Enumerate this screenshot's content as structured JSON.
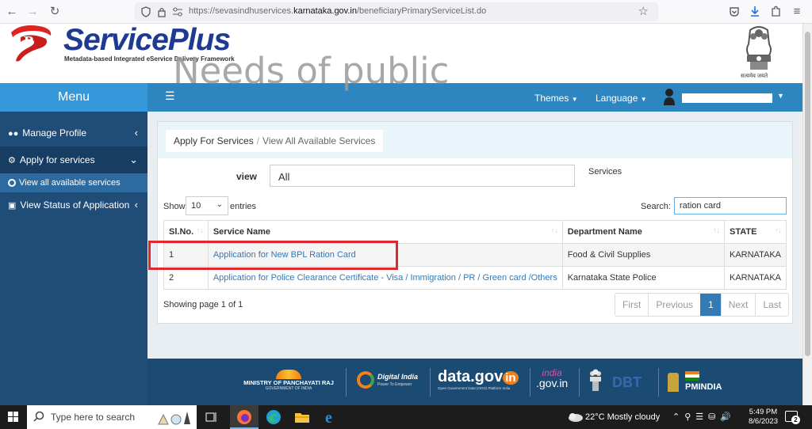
{
  "browser": {
    "url_prefix": "https://sevasindhuservices.",
    "url_domain": "karnataka.gov.in",
    "url_path": "/beneficiaryPrimaryServiceList.do"
  },
  "header": {
    "brand": "ServicePlus",
    "tagline": "Metadata-based Integrated eService Delivery Framework",
    "emblem_motto": "सत्यमेव जयते"
  },
  "sidebar": {
    "menu_title": "Menu",
    "items": [
      {
        "label": "Manage Profile",
        "icon": "users-icon"
      },
      {
        "label": "Apply for services",
        "icon": "cogs-icon"
      },
      {
        "label": "View Status of Application",
        "icon": "desktop-icon"
      }
    ],
    "subitem": "View all available services"
  },
  "topbar": {
    "themes": "Themes",
    "language": "Language"
  },
  "breadcrumb": {
    "root": "Apply For Services",
    "current": "View All Available Services"
  },
  "filters": {
    "view_label": "view",
    "view_value": "All",
    "services_label": "Services",
    "show_label": "Show",
    "entries_value": "10",
    "entries_label": "entries",
    "search_label": "Search:",
    "search_value": "ration card"
  },
  "watermark": "Needs of public",
  "table": {
    "headers": [
      "Sl.No.",
      "Service Name",
      "Department Name",
      "STATE"
    ],
    "rows": [
      {
        "sl": "1",
        "service": "Application for New BPL Ration Card",
        "dept": "Food & Civil Supplies",
        "state": "KARNATAKA"
      },
      {
        "sl": "2",
        "service": "Application for Police Clearance Certificate - Visa / Immigration / PR / Green card /Others",
        "dept": "Karnataka State Police",
        "state": "KARNATAKA"
      }
    ]
  },
  "pagination": {
    "info": "Showing page 1 of 1",
    "first": "First",
    "previous": "Previous",
    "current": "1",
    "next": "Next",
    "last": "Last"
  },
  "footer": {
    "panchayati": "MINISTRY OF PANCHAYATI RAJ",
    "panchayati_sub": "GOVERNMENT OF INDIA",
    "digital_india": "Digital India",
    "digital_india_sub": "Power To Empower",
    "data_gov": "data.gov",
    "data_gov_in": "in",
    "data_gov_sub": "Open Government Data (OGD) Platform India",
    "india_top": "india",
    "india_bottom": ".gov.in",
    "dbt": "DBT",
    "pmindia": "PMINDIA"
  },
  "taskbar": {
    "search_placeholder": "Type here to search",
    "weather": "22°C  Mostly cloudy",
    "time": "5:49 PM",
    "date": "8/6/2023",
    "notifications": "2"
  },
  "colors": {
    "sidebar": "#1f4d78",
    "accent": "#3498db",
    "topbar": "#2e86c1",
    "highlight": "#e0272e"
  }
}
